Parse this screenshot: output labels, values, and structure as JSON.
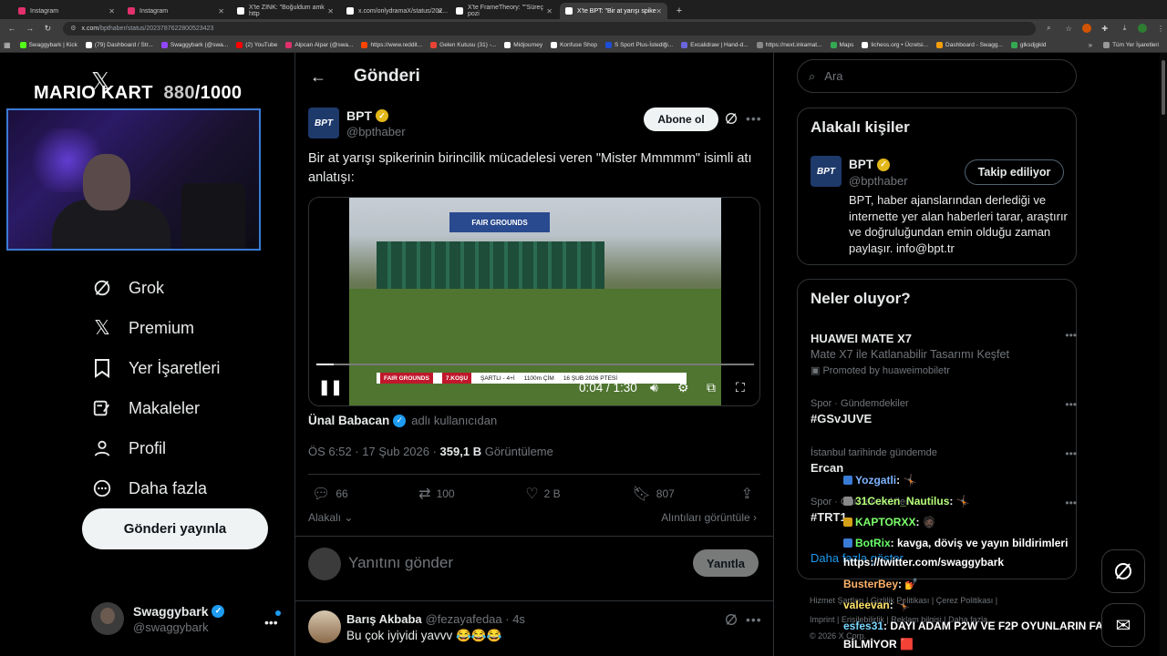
{
  "browser": {
    "tabs": [
      {
        "title": "Instagram",
        "color": "#e1306c"
      },
      {
        "title": "Instagram",
        "color": "#e1306c"
      },
      {
        "title": "X'te ZINK: \"Boğuldum amk http",
        "color": "#ffffff"
      },
      {
        "title": "x.com/onlydramaX/status/202...",
        "color": "#ffffff"
      },
      {
        "title": "X'te FrameTheory: \"\"Süreç pozi",
        "color": "#ffffff"
      },
      {
        "title": "X'te BPT: \"Bir at yarışı spike",
        "color": "#ffffff"
      }
    ],
    "new_tab": "+",
    "url_host": "x.com",
    "url_path": "/bpthaber/status/2023787622800523423",
    "bookmarks": [
      {
        "label": "Swaggybark | Kick",
        "color": "#53fc18"
      },
      {
        "label": "(79) Dashboard / Str...",
        "color": "#ffffff"
      },
      {
        "label": "Swaggybark (@swa...",
        "color": "#9146ff"
      },
      {
        "label": "(2) YouTube",
        "color": "#ff0000"
      },
      {
        "label": "Alpcan Alpar (@swa...",
        "color": "#e1306c"
      },
      {
        "label": "https://www.reddit...",
        "color": "#ff4500"
      },
      {
        "label": "Gelen Kutusu (31) -...",
        "color": "#ea4335"
      },
      {
        "label": "Midjourney",
        "color": "#ffffff"
      },
      {
        "label": "Konfuse Shop",
        "color": "#ffffff"
      },
      {
        "label": "S Sport Plus-İstediği...",
        "color": "#1d4ed8"
      },
      {
        "label": "Excalidraw | Hand-d...",
        "color": "#6965db"
      },
      {
        "label": "https://next.inkamat...",
        "color": "#888888"
      },
      {
        "label": "Maps",
        "color": "#34a853"
      },
      {
        "label": "lichess.org • Ücretsi...",
        "color": "#ffffff"
      },
      {
        "label": "Dashboard - Swagg...",
        "color": "#f59e0b"
      },
      {
        "label": "glksdjgkld",
        "color": "#34a853"
      }
    ],
    "bookmarks_more": "»",
    "all_bookmarks": "Tüm Yer İşaretleri"
  },
  "stream": {
    "title": "MARIO KART",
    "count": "880",
    "total": "/1000"
  },
  "sidebar": {
    "items": [
      {
        "label": "Grok",
        "icon": "grok-icon"
      },
      {
        "label": "Premium",
        "icon": "x-icon"
      },
      {
        "label": "Yer İşaretleri",
        "icon": "bookmark-icon"
      },
      {
        "label": "Makaleler",
        "icon": "article-icon"
      },
      {
        "label": "Profil",
        "icon": "profile-icon"
      },
      {
        "label": "Daha fazla",
        "icon": "more-icon"
      }
    ],
    "post_button": "Gönderi yayınla",
    "me": {
      "name": "Swaggybark",
      "handle": "@swaggybark"
    }
  },
  "post": {
    "header": "Gönderi",
    "author": "BPT",
    "avatar_text": "BPT",
    "handle": "@bpthaber",
    "follow_label": "Abone ol",
    "text": "Bir at yarışı spikerinin birincilik mücadelesi veren \"Mister Mmmmm\" isimli atı anlatışı:",
    "video": {
      "time": "0:04 / 1:30",
      "progress": 0.04,
      "banner": "FAIR GROUNDS",
      "lower_third": [
        "FAIR GROUNDS",
        "7.KOŞU",
        "ŞARTLI - 4+İ",
        "1100m ÇİM",
        "16 ŞUB 2026 PTESİ"
      ]
    },
    "reposter": "Ünal Babacan",
    "reposter_sub": "adlı kullanıcıdan",
    "time": "ÖS 6:52 · 17 Şub 2026 · ",
    "views": "359,1 B",
    "views_label": " Görüntüleme",
    "stats": {
      "replies": "66",
      "reposts": "100",
      "likes": "2 B",
      "bookmarks": "807"
    },
    "related": "Alakalı",
    "quotes": "Alıntıları görüntüle",
    "reply_placeholder": "Yanıtını gönder",
    "reply_button": "Yanıtla"
  },
  "comment": {
    "name": "Barış Akbaba",
    "handle": "@fezayafedaa · 4s",
    "text": "Bu çok iyiyidi yavvv 😂😂😂"
  },
  "right": {
    "search_placeholder": "Ara",
    "related_title": "Alakalı kişiler",
    "related": {
      "name": "BPT",
      "handle": "@bpthaber",
      "follow": "Takip ediliyor",
      "bio": "BPT, haber ajanslarından derlediği ve internette yer alan haberleri tarar, araştırır ve doğruluğundan emin olduğu zaman paylaşır. info@bpt.tr"
    },
    "trends_title": "Neler oluyor?",
    "trends": [
      {
        "ctx": "",
        "title": "HUAWEI MATE X7",
        "sub": "Mate X7 ile Katlanabilir Tasarımı Keşfet",
        "promo": "Promoted by huaweimobiletr"
      },
      {
        "ctx": "Spor · Gündemdekiler",
        "title": "#GSvJUVE",
        "sub": "",
        "promo": ""
      },
      {
        "ctx": "İstanbul tarihinde gündemde",
        "title": "Ercan",
        "sub": "",
        "promo": ""
      },
      {
        "ctx": "Spor · Gündemdekiler",
        "title": "#TRT1",
        "sub": "",
        "promo": ""
      }
    ],
    "show_more": "Daha fazla göster",
    "footer": [
      "Hizmet Şartları",
      "Gizlilik Politikası",
      "Çerez Politikası",
      "Imprint",
      "Erişilebilirlik",
      "Reklam bilgisi",
      "Daha fazla ...",
      "© 2026 X Corp."
    ]
  },
  "chat": [
    {
      "user": "Yozgatli",
      "user_color": "#7fb3ff",
      "msg": " : 🤸🏿"
    },
    {
      "user": "31Ceken_Nautilus",
      "user_color": "#b6ff7a",
      "msg": " : 🤸🏿"
    },
    {
      "user": "KAPTORXX",
      "user_color": "#7dff6b",
      "msg": " : 🧔🏿"
    },
    {
      "user": "BotRix",
      "user_color": "#6bff6b",
      "msg": " : kavga, döviş ve yayın bildirimleri"
    },
    {
      "user": "",
      "user_color": "#ffffff",
      "msg": "https://twitter.com/swaggybark"
    },
    {
      "user": "BusterBey",
      "user_color": "#ffb36b",
      "msg": " : 💅"
    },
    {
      "user": "valeevan",
      "user_color": "#ffe36b",
      "msg": " : 🤸🏿"
    },
    {
      "user": "esfes31",
      "user_color": "#7ad8ff",
      "msg": " : DAYI ADAM P2W VE F2P OYUNLARIN FARKINI"
    },
    {
      "user": "",
      "user_color": "#ffffff",
      "msg": "BİLMİYOR 🟥"
    }
  ],
  "colors": {
    "accent": "#1d9bf0",
    "verified_gold": "#e2b719",
    "stream_border": "#3a7bd5"
  }
}
